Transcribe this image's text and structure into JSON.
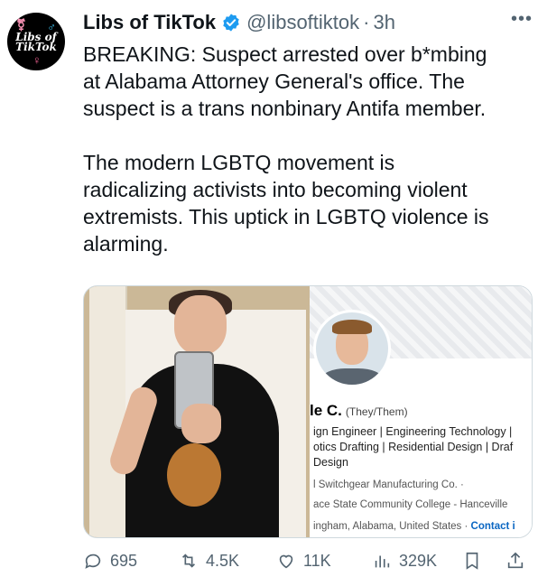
{
  "account": {
    "name": "Libs of TikTok",
    "handle": "@libsoftiktok",
    "time": "3h",
    "avatar_text": "Libs of TikTok"
  },
  "tweet": {
    "text": "BREAKING: Suspect arrested over b*mbing\nat Alabama Attorney General's office. The\nsuspect is a trans nonbinary Antifa member.\n\nThe modern LGBTQ movement is\nradicalizing activists into becoming violent\nextremists. This uptick in LGBTQ violence is\nalarming."
  },
  "linkedin": {
    "name": "le C.",
    "pronouns": "(They/Them)",
    "headline_1": "ign Engineer | Engineering Technology |",
    "headline_2": "otics Drafting | Residential Design | Draf",
    "headline_3": "Design",
    "company": "l Switchgear Manufacturing Co. ·",
    "school": "ace State Community College - Hanceville",
    "location": "ingham, Alabama, United States ·",
    "contact": "Contact i"
  },
  "actions": {
    "replies": "695",
    "retweets": "4.5K",
    "likes": "11K",
    "views": "329K"
  },
  "colors": {
    "verified": "#1d9bf0",
    "secondary_text": "#536471"
  }
}
